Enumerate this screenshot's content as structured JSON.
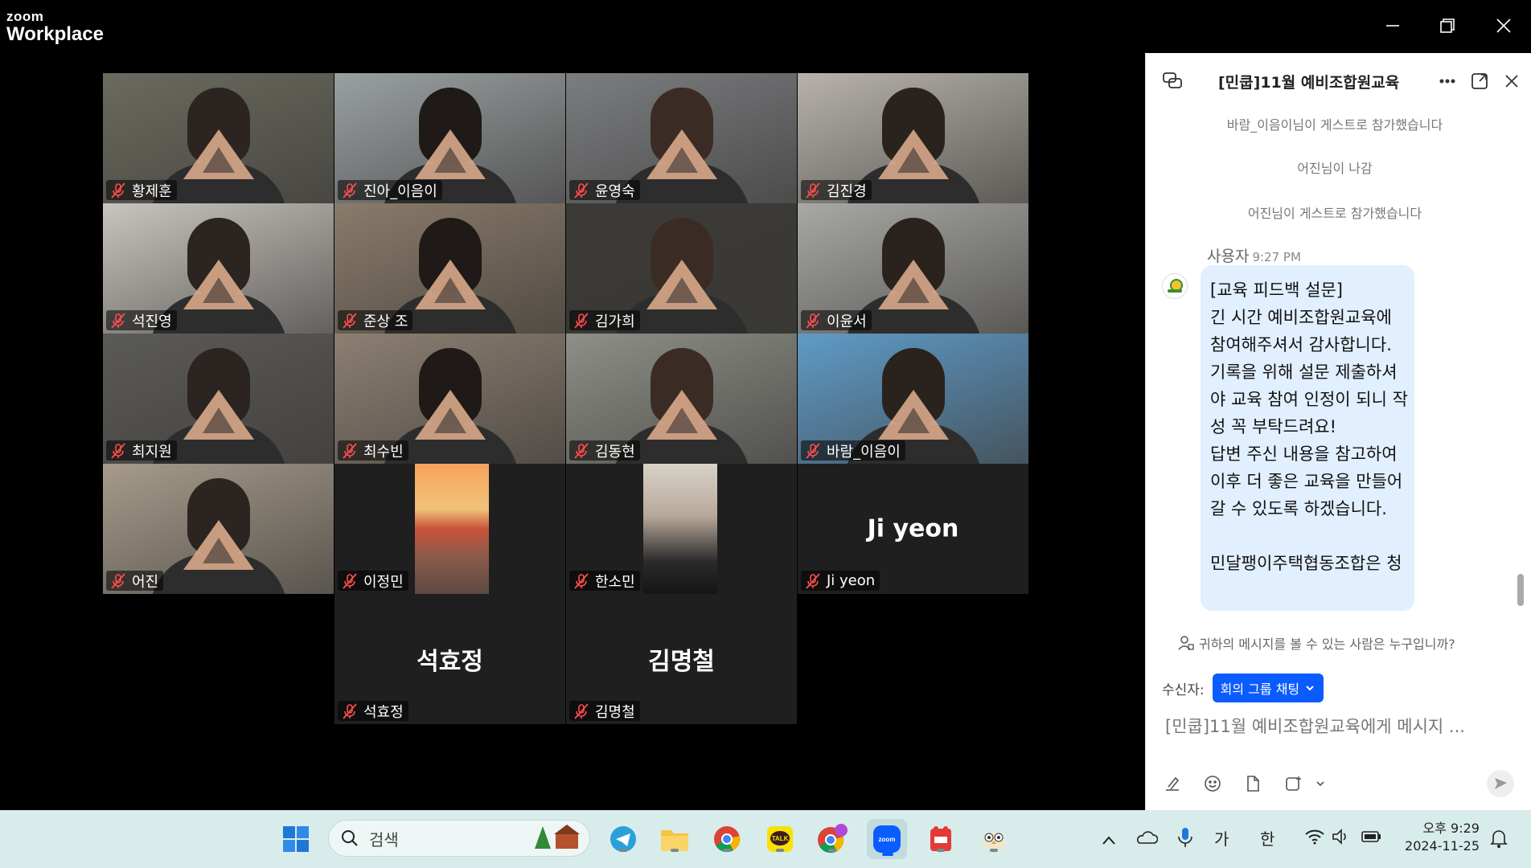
{
  "app": {
    "brand_small": "zoom",
    "brand_large": "Workplace"
  },
  "participants": [
    {
      "name": "황제훈",
      "bg": "#6b6a5e"
    },
    {
      "name": "진아_이음이",
      "bg": "#9aa0a2"
    },
    {
      "name": "윤영숙",
      "bg": "#7b7d80"
    },
    {
      "name": "김진경",
      "bg": "#b7b3ab"
    },
    {
      "name": "석진영",
      "bg": "#c8c4bf"
    },
    {
      "name": "준상 조",
      "bg": "#8a7b6a"
    },
    {
      "name": "김가희",
      "bg": "#3b3a36"
    },
    {
      "name": "이윤서",
      "bg": "#a8a8a5"
    },
    {
      "name": "최지원",
      "bg": "#5b5a57"
    },
    {
      "name": "최수빈",
      "bg": "#8c7f72"
    },
    {
      "name": "김동현",
      "bg": "#8e8f88"
    },
    {
      "name": "바람_이음이",
      "bg": "#5f9bc7"
    },
    {
      "name": "어진",
      "bg": "#a69b8b"
    },
    {
      "name": "이정민",
      "bg": "#1f1f1f"
    },
    {
      "name": "한소민",
      "bg": "#1f1f1f"
    },
    {
      "name": "Ji yeon",
      "big": "Ji yeon",
      "bg": "#1f1f1f"
    },
    {
      "name": "석효정",
      "big": "석효정",
      "bg": "#1f1f1f"
    },
    {
      "name": "김명철",
      "big": "김명철",
      "bg": "#1f1f1f"
    }
  ],
  "chat": {
    "title": "[민쿱]11월 예비조합원교육",
    "system_messages": [
      "바람_이음이님이 게스트로 참가했습니다",
      "어진님이 나감",
      "어진님이 게스트로 참가했습니다"
    ],
    "sender": "사용자",
    "time": "9:27 PM",
    "message_lines": [
      "[교육 피드백 설문]",
      "긴 시간 예비조합원교육에",
      "참여해주셔서 감사합니다.",
      "기록을 위해 설문 제출하셔",
      "야 교육 참여 인정이 되니 작",
      "성 꼭 부탁드려요!",
      "답변 주신 내용을 참고하여",
      "이후 더 좋은 교육을 만들어",
      "갈 수 있도록 하겠습니다.",
      "",
      "민달팽이주택협동조합은 청"
    ],
    "who_can_see": "귀하의 메시지를 볼 수 있는 사람은 누구입니까?",
    "recipient_label": "수신자:",
    "recipient_value": "회의 그룹 채팅",
    "input_placeholder": "[민쿱]11월 예비조합원교육에게 메시지 ..."
  },
  "taskbar": {
    "search_placeholder": "검색",
    "ime_ga": "가",
    "ime_han": "한",
    "clock_time": "오후 9:29",
    "clock_date": "2024-11-25"
  },
  "colors": {
    "active_speaker": "#2bd57d",
    "accent": "#0b5cff",
    "muted_mic": "#e02828"
  }
}
